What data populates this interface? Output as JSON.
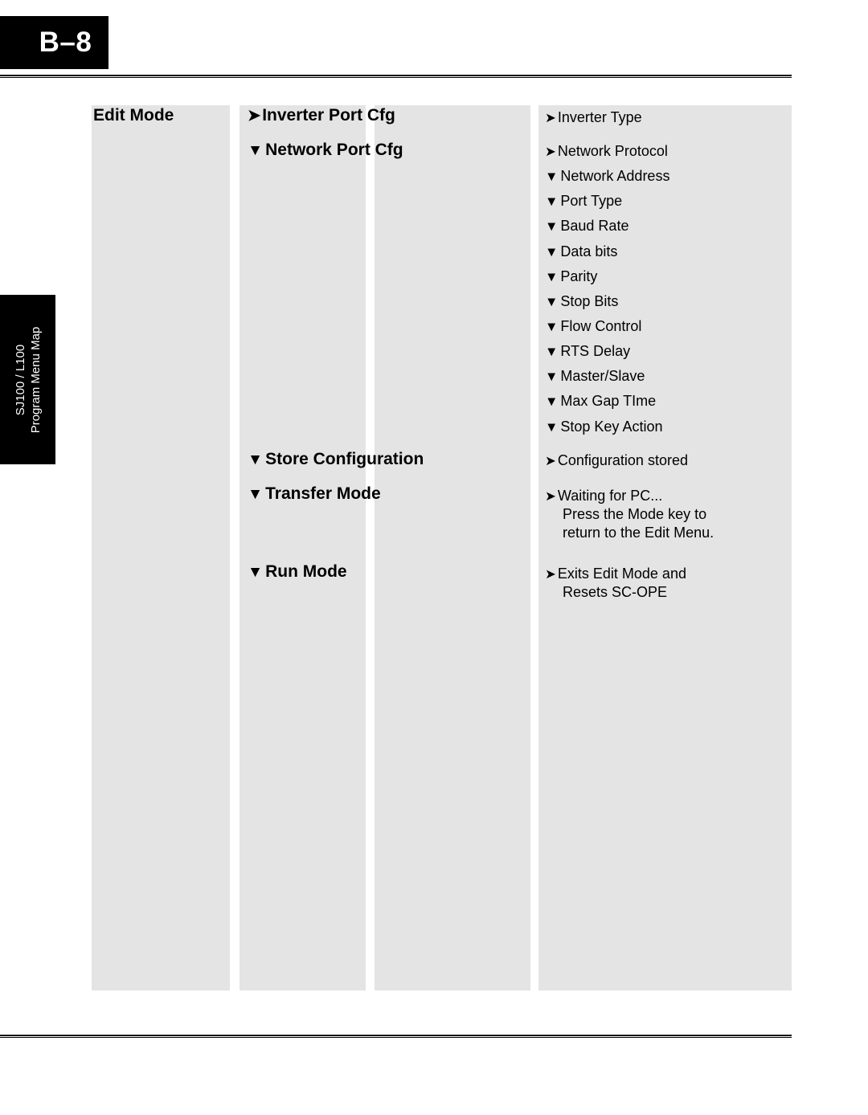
{
  "page": {
    "tag": "B–8",
    "side_tab": {
      "line1": "SJ100 / L100",
      "line2": "Program Menu Map"
    }
  },
  "icons": {
    "arrow_right": "➤",
    "arrow_down": "▼"
  },
  "menu": {
    "col1": [
      {
        "label": "Edit Mode",
        "marker": "none"
      }
    ],
    "col2": [
      {
        "label": "Inverter Port Cfg",
        "marker": "arrow-right"
      },
      {
        "label": "Network Port Cfg",
        "marker": "arrow-down"
      },
      {
        "label": "Store Configuration",
        "marker": "arrow-down"
      },
      {
        "label": "Transfer Mode",
        "marker": "arrow-down"
      },
      {
        "label": "Run Mode",
        "marker": "arrow-down"
      }
    ],
    "col4": [
      {
        "label": "Inverter Type",
        "marker": "arrow-right"
      },
      {
        "label": "Network Protocol",
        "marker": "arrow-right"
      },
      {
        "label": "Network Address",
        "marker": "arrow-down"
      },
      {
        "label": "Port Type",
        "marker": "arrow-down"
      },
      {
        "label": "Baud Rate",
        "marker": "arrow-down"
      },
      {
        "label": "Data bits",
        "marker": "arrow-down"
      },
      {
        "label": "Parity",
        "marker": "arrow-down"
      },
      {
        "label": "Stop Bits",
        "marker": "arrow-down"
      },
      {
        "label": "Flow Control",
        "marker": "arrow-down"
      },
      {
        "label": "RTS Delay",
        "marker": "arrow-down"
      },
      {
        "label": "Master/Slave",
        "marker": "arrow-down"
      },
      {
        "label": "Max Gap TIme",
        "marker": "arrow-down"
      },
      {
        "label": "Stop Key Action",
        "marker": "arrow-down"
      },
      {
        "label": "Configuration stored",
        "marker": "arrow-right"
      },
      {
        "label": "Waiting for PC...",
        "marker": "arrow-right",
        "cont1": "Press the Mode key to",
        "cont2": "return to the Edit Menu."
      },
      {
        "label": "Exits Edit Mode and",
        "marker": "arrow-right",
        "cont1": "Resets SC-OPE"
      }
    ]
  },
  "colors": {
    "column_fill": "#e4e4e4",
    "tag_fill": "#000000",
    "text": "#000000"
  }
}
